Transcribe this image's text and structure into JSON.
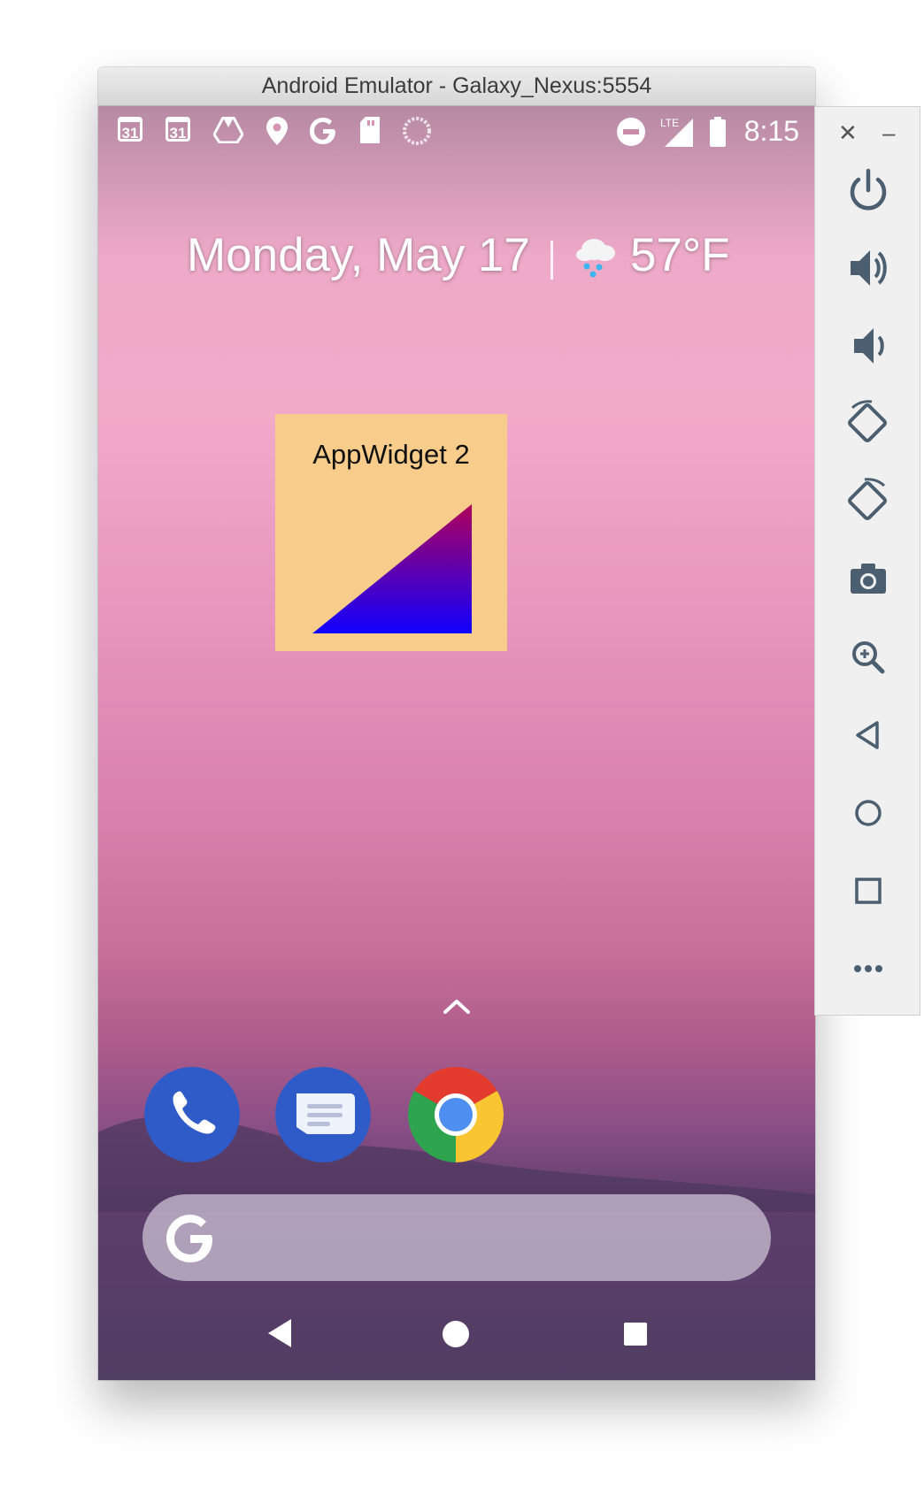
{
  "window": {
    "title": "Android Emulator - Galaxy_Nexus:5554"
  },
  "status_bar": {
    "left_icons": [
      {
        "icon": "calendar-icon",
        "label": "31"
      },
      {
        "icon": "calendar-icon",
        "label": "31"
      },
      {
        "icon": "drive-icon"
      },
      {
        "icon": "location-icon"
      },
      {
        "icon": "google-icon"
      },
      {
        "icon": "sd-card-icon"
      },
      {
        "icon": "loading-icon"
      }
    ],
    "right_icons": [
      "do-not-disturb-icon",
      "signal-lte-icon",
      "battery-icon"
    ],
    "network": "LTE",
    "time": "8:15"
  },
  "at_a_glance": {
    "date": "Monday, May 17",
    "weather_icon": "snow-cloud-icon",
    "temperature": "57°F"
  },
  "widget": {
    "label": "AppWidget 2",
    "background": "#f8cc8a",
    "gradient_top": "#b0005a",
    "gradient_bottom": "#1000ff"
  },
  "dock": {
    "apps": [
      {
        "name": "Phone",
        "icon": "phone-icon",
        "color": "#2f5bc8"
      },
      {
        "name": "Messages",
        "icon": "messages-icon",
        "color": "#2f5bc8"
      },
      {
        "name": "Chrome",
        "icon": "chrome-icon"
      }
    ]
  },
  "search": {
    "logo": "google-g-icon"
  },
  "nav": [
    "back-icon",
    "home-icon",
    "recents-icon"
  ],
  "toolbar": {
    "window_controls": [
      "close-icon",
      "minimize-icon"
    ],
    "buttons": [
      "power-icon",
      "volume-up-icon",
      "volume-down-icon",
      "rotate-left-icon",
      "rotate-right-icon",
      "camera-icon",
      "zoom-icon",
      "back-icon",
      "home-icon",
      "overview-icon",
      "more-icon"
    ]
  }
}
